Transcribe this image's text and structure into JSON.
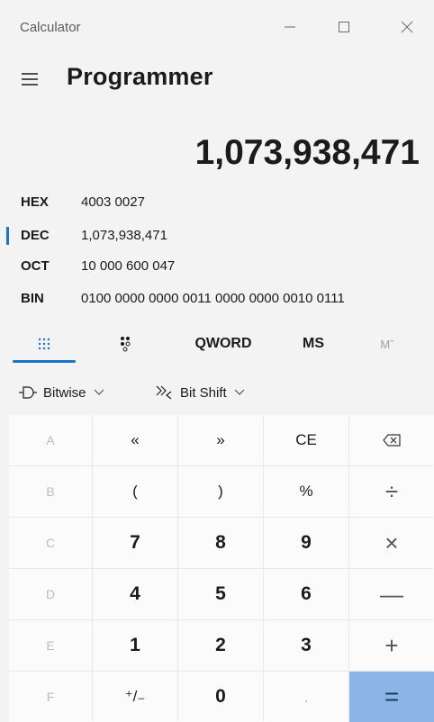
{
  "window": {
    "title": "Calculator"
  },
  "header": {
    "mode": "Programmer"
  },
  "display": {
    "value": "1,073,938,471"
  },
  "radix": [
    {
      "label": "HEX",
      "value": "4003 0027",
      "selected": false
    },
    {
      "label": "DEC",
      "value": "1,073,938,471",
      "selected": true
    },
    {
      "label": "OCT",
      "value": "10 000 600 047",
      "selected": false
    },
    {
      "label": "BIN",
      "value": "0100 0000 0000 0011 0000 0000 0010 0111",
      "selected": false
    }
  ],
  "toolbar": {
    "keypad_icon": "full-keypad-icon",
    "bit_icon": "bit-toggle-keypad-icon",
    "word_size": "QWORD",
    "memory_store": "MS",
    "memory_list": "Mˇ"
  },
  "bitwise": {
    "bitwise_label": "Bitwise",
    "bitshift_label": "Bit Shift"
  },
  "keys": [
    [
      "A",
      "«",
      "»",
      "CE",
      "⌫"
    ],
    [
      "B",
      "(",
      ")",
      "%",
      "÷"
    ],
    [
      "C",
      "7",
      "8",
      "9",
      "×"
    ],
    [
      "D",
      "4",
      "5",
      "6",
      "—"
    ],
    [
      "E",
      "1",
      "2",
      "3",
      "+"
    ],
    [
      "F",
      "⁺/₋",
      "0",
      ".",
      "="
    ]
  ],
  "colors": {
    "accent": "#1a73c9",
    "equals_bg": "#8ab5e5",
    "background": "#f3f3f3"
  }
}
